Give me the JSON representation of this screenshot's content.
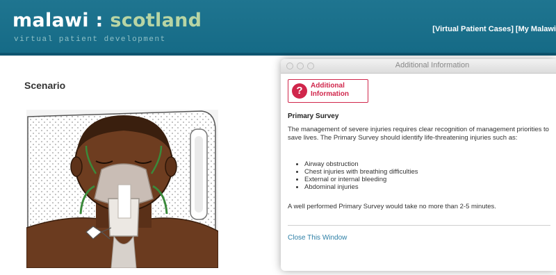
{
  "header": {
    "brand_main": "malawi",
    "brand_sep": " : ",
    "brand_accent": "scotland",
    "tagline": "virtual patient development",
    "nav_cases": "[Virtual Patient Cases]",
    "nav_my": "[My Malawi"
  },
  "scenario": {
    "title": "Scenario"
  },
  "popup": {
    "window_title": "Additional Information",
    "badge_icon": "question-icon",
    "badge_line1": "Additional",
    "badge_line2": "Information",
    "section_title": "Primary Survey",
    "paragraph1": "The management of severe injuries requires clear recognition of management priorities to save lives. The Primary Survey should identify life-threatening injuries such as:",
    "items": [
      "Airway obstruction",
      "Chest injuries with breathing difficulties",
      "External or internal bleeding",
      "Abdominal injuries"
    ],
    "paragraph2": "A well performed Primary Survey would take no more than 2-5 minutes.",
    "close_link": "Close This Window"
  },
  "colors": {
    "header_bg": "#1b7089",
    "brand_accent": "#b8d5a4",
    "alert_red": "#d0264b",
    "link_blue": "#2d7fa6"
  }
}
